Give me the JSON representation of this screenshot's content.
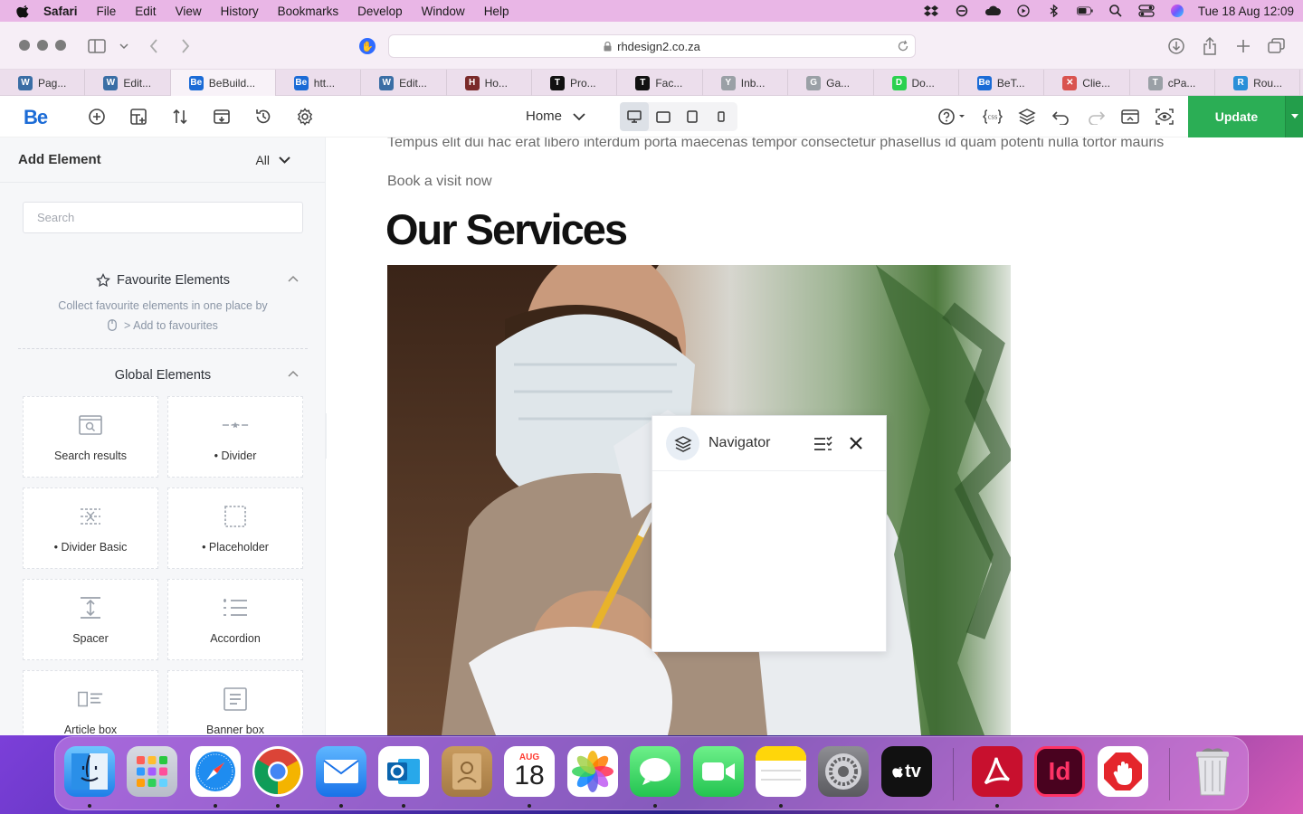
{
  "menubar": {
    "app": "Safari",
    "items": [
      "File",
      "Edit",
      "View",
      "History",
      "Bookmarks",
      "Develop",
      "Window",
      "Help"
    ],
    "clock": "Tue 18 Aug  12:09"
  },
  "browser": {
    "url": "rhdesign2.co.za",
    "tabs": [
      {
        "label": "Pag...",
        "icon": "wordpress-icon",
        "color": "#3a6ea5"
      },
      {
        "label": "Edit...",
        "icon": "wordpress-icon",
        "color": "#3a6ea5"
      },
      {
        "label": "BeBuild...",
        "icon": "be-icon",
        "color": "#1b6bd6"
      },
      {
        "label": "htt...",
        "icon": "be-icon",
        "color": "#1b6bd6"
      },
      {
        "label": "Edit...",
        "icon": "wordpress-icon",
        "color": "#3a6ea5"
      },
      {
        "label": "Ho...",
        "icon": "ho-icon",
        "color": "#7a2a2a"
      },
      {
        "label": "Pro...",
        "icon": "t-icon",
        "color": "#111111"
      },
      {
        "label": "Fac...",
        "icon": "t-icon",
        "color": "#111111"
      },
      {
        "label": "Inb...",
        "icon": "y-icon",
        "color": "#9aa0a6"
      },
      {
        "label": "Ga...",
        "icon": "g-icon",
        "color": "#9aa0a6"
      },
      {
        "label": "Do...",
        "icon": "do-icon",
        "color": "#2bd14f"
      },
      {
        "label": "BeT...",
        "icon": "be-icon",
        "color": "#1b6bd6"
      },
      {
        "label": "Clie...",
        "icon": "x-icon",
        "color": "#d9534f"
      },
      {
        "label": "cPa...",
        "icon": "t-icon",
        "color": "#9aa0a6"
      },
      {
        "label": "Rou...",
        "icon": "rou-icon",
        "color": "#2a8fd8"
      }
    ]
  },
  "builder": {
    "logo": "Be",
    "page_select": "Home",
    "update_label": "Update",
    "accent": "#2bae55"
  },
  "sidebar": {
    "title": "Add Element",
    "filter": "All",
    "search_placeholder": "Search",
    "favourites": {
      "title": "Favourite Elements",
      "note_line1": "Collect favourite elements in one place by",
      "note_line2": "> Add to favourites"
    },
    "global": {
      "title": "Global Elements",
      "items": [
        {
          "label": "Search results",
          "icon": "search-results-icon"
        },
        {
          "label": "• Divider",
          "icon": "divider-icon"
        },
        {
          "label": "• Divider Basic",
          "icon": "divider-basic-icon"
        },
        {
          "label": "• Placeholder",
          "icon": "placeholder-icon"
        },
        {
          "label": "Spacer",
          "icon": "spacer-icon"
        },
        {
          "label": "Accordion",
          "icon": "accordion-icon"
        },
        {
          "label": "Article box",
          "icon": "article-box-icon"
        },
        {
          "label": "Banner box",
          "icon": "banner-box-icon"
        }
      ]
    }
  },
  "canvas": {
    "lorem": "Tempus elit dui hac erat libero interdum porta maecenas tempor consectetur phasellus id quam potenti nulla tortor mauris",
    "book": "Book a visit now",
    "heading": "Our Services"
  },
  "navigator": {
    "title": "Navigator"
  },
  "dock": {
    "calendar_month": "AUG",
    "calendar_day": "18",
    "tv_label": "tv"
  }
}
